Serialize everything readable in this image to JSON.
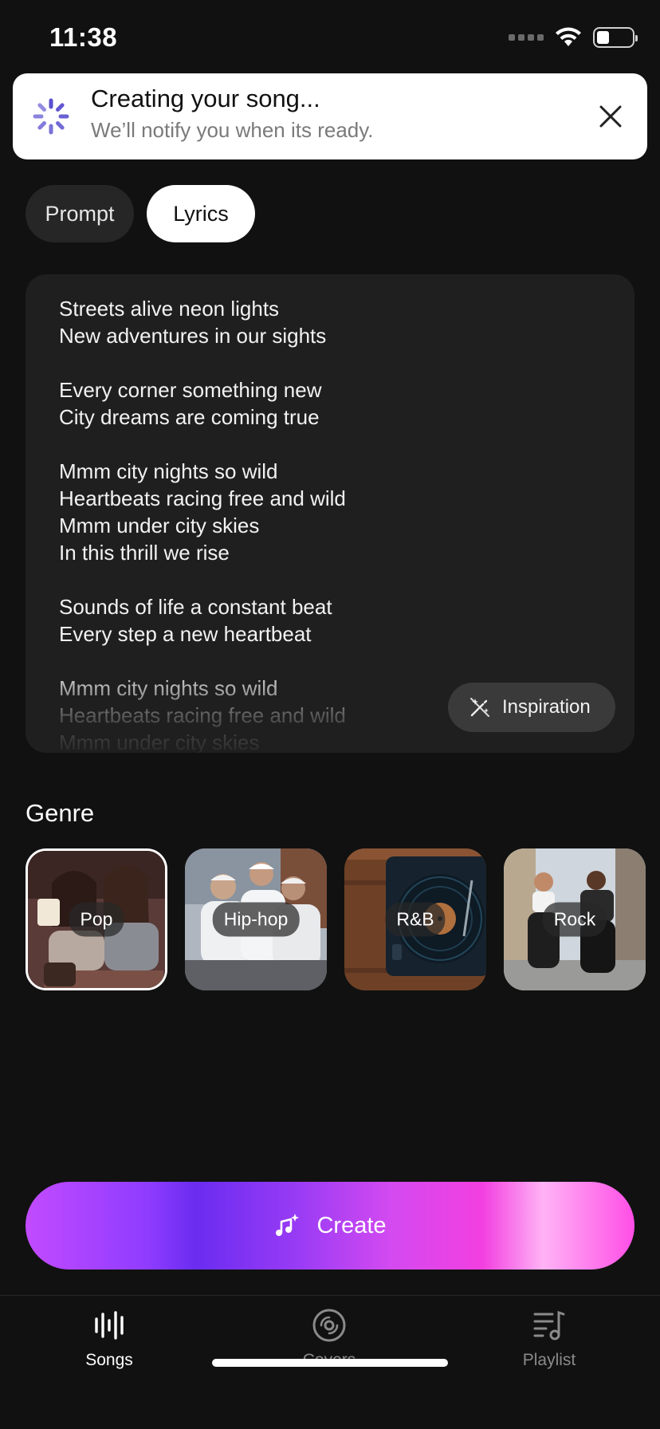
{
  "status_bar": {
    "time": "11:38",
    "battery_level": 0.36
  },
  "banner": {
    "title": "Creating your song...",
    "subtitle": "We’ll notify you when its ready.",
    "spinner_color": "#5a4fd0"
  },
  "tabs": [
    {
      "label": "Prompt",
      "selected": false
    },
    {
      "label": "Lyrics",
      "selected": true
    }
  ],
  "lyrics": {
    "lines": [
      "Streets alive neon lights",
      "New adventures in our sights",
      "",
      "Every corner something new",
      "City dreams are coming true",
      "",
      "Mmm city nights so wild",
      "Heartbeats racing free and wild",
      "Mmm under city skies",
      "In this thrill we rise",
      "",
      "Sounds of life a constant beat",
      "Every step a new heartbeat",
      "",
      "Mmm city nights so wild",
      "Heartbeats racing free and wild",
      "Mmm under city skies"
    ],
    "inspiration_label": "Inspiration"
  },
  "genre": {
    "heading": "Genre",
    "items": [
      {
        "label": "Pop",
        "selected": true
      },
      {
        "label": "Hip-hop",
        "selected": false
      },
      {
        "label": "R&B",
        "selected": false
      },
      {
        "label": "Rock",
        "selected": false
      }
    ]
  },
  "create_button": {
    "label": "Create"
  },
  "nav": {
    "items": [
      {
        "label": "Songs",
        "icon": "waveform-icon",
        "active": true
      },
      {
        "label": "Covers",
        "icon": "disc-icon",
        "active": false
      },
      {
        "label": "Playlist",
        "icon": "playlist-icon",
        "active": false
      }
    ]
  },
  "colors": {
    "background": "#111111",
    "card": "#1f1f1f",
    "accent_gradient": [
      "#c24bff",
      "#6a2cf0",
      "#f23fe0",
      "#ffb3f5"
    ]
  }
}
